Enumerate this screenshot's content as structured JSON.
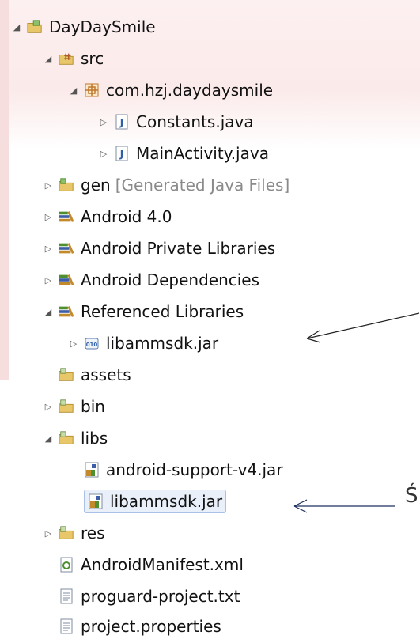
{
  "tree": {
    "root": "DayDaySmile",
    "src": "src",
    "package": "com.hzj.daydaysmile",
    "file_constants": "Constants.java",
    "file_main": "MainActivity.java",
    "gen": "gen",
    "gen_suffix": "[Generated Java Files]",
    "android40": "Android 4.0",
    "private_libs": "Android Private Libraries",
    "dependencies": "Android Dependencies",
    "referenced": "Referenced Libraries",
    "ref_jar": "libammsdk.jar",
    "assets": "assets",
    "bin": "bin",
    "libs": "libs",
    "support_jar": "android-support-v4.jar",
    "libs_jar": "libammsdk.jar",
    "res": "res",
    "manifest": "AndroidManifest.xml",
    "proguard": "proguard-project.txt",
    "properties": "project.properties"
  },
  "annotation": {
    "cut_text": "Ś"
  },
  "colors": {
    "folder": "#d9b650",
    "java_blue": "#2f5fa8",
    "library_green": "#4e8f2f",
    "library_blue": "#3c5ea8",
    "selection": "#e9f0fa",
    "generated_gray": "#8a8a8a"
  }
}
